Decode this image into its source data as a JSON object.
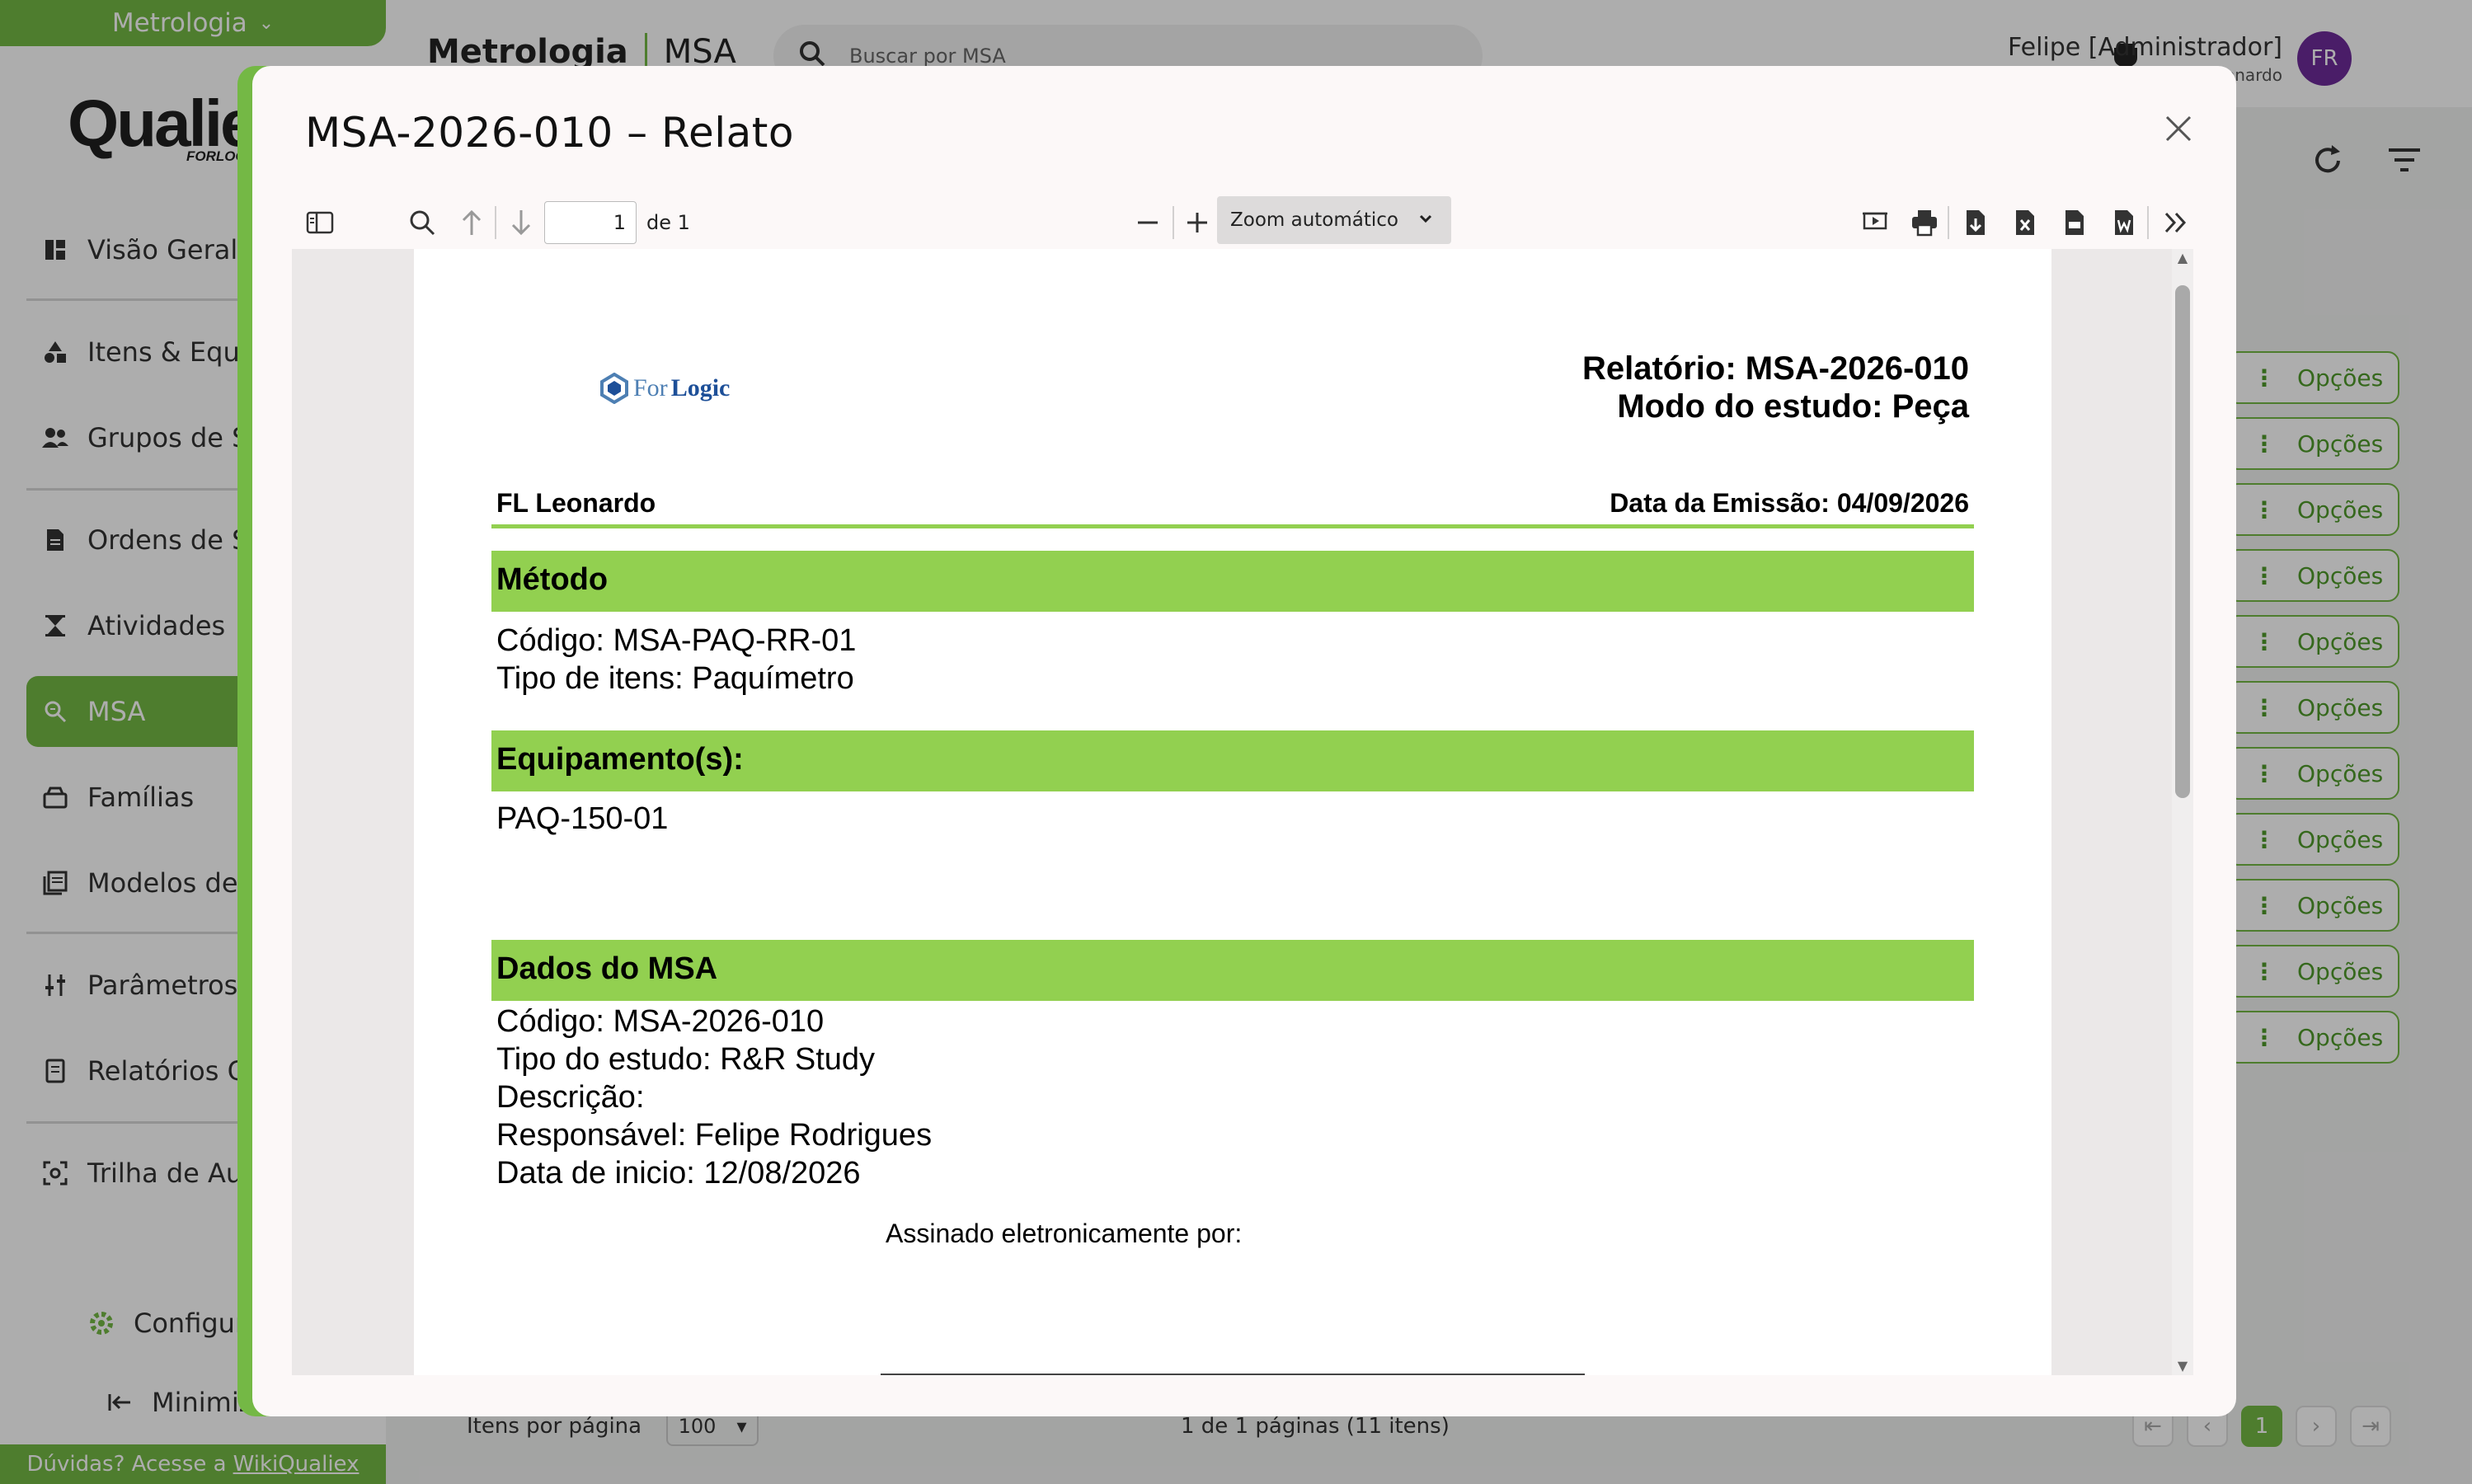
{
  "app": {
    "module": "Metrologia",
    "brand": "Qualiex",
    "brand_sub": "FORLOGIC"
  },
  "sidebar": {
    "items": [
      {
        "label": "Visão Geral",
        "icon": "dashboard-icon"
      },
      {
        "label": "Itens & Equipamentos",
        "icon": "shapes-icon"
      },
      {
        "label": "Grupos de Segurança",
        "icon": "users-icon"
      },
      {
        "label": "Ordens de Serviço",
        "icon": "document-icon"
      },
      {
        "label": "Atividades",
        "icon": "hourglass-icon"
      },
      {
        "label": "MSA",
        "icon": "search-icon"
      },
      {
        "label": "Famílias",
        "icon": "archive-icon"
      },
      {
        "label": "Modelos de Relatório",
        "icon": "list-icon"
      },
      {
        "label": "Parâmetros",
        "icon": "sliders-icon"
      },
      {
        "label": "Relatórios Gerenciais",
        "icon": "report-icon"
      },
      {
        "label": "Trilha de Auditoria",
        "icon": "audit-icon"
      }
    ],
    "config_label": "Configurações",
    "minimize_label": "Minimizar",
    "help_prefix": "Dúvidas? Acesse a",
    "help_link": "WikiQualiex"
  },
  "header": {
    "crumb_module": "Metrologia",
    "crumb_page": "MSA",
    "search_placeholder": "Buscar por MSA",
    "user_name": "Felipe [Administrador]",
    "user_org": "FL Leonardo",
    "avatar_initials": "FR"
  },
  "table": {
    "options_label": "Opções",
    "row_count": 11,
    "items_per_page_label": "Itens por página",
    "items_per_page": "100",
    "page_info": "1 de 1 páginas (11 itens)",
    "current_page": "1"
  },
  "modal": {
    "title": "MSA-2026-010 – Relato",
    "viewer": {
      "page_number": "1",
      "page_total": "de 1",
      "zoom": "Zoom automático"
    }
  },
  "report": {
    "title_line1": "Relatório: MSA-2026-010",
    "title_line2": "Modo do estudo: Peça",
    "org": "FL Leonardo",
    "emission": "Data da Emissão: 04/09/2026",
    "method_header": "Método",
    "method_code": "Código: MSA-PAQ-RR-01",
    "method_type": "Tipo de itens: Paquímetro",
    "equip_header": "Equipamento(s):",
    "equip_item": "PAQ-150-01",
    "data_header": "Dados do MSA",
    "data_code": "Código: MSA-2026-010",
    "data_type": "Tipo do estudo: R&R Study",
    "data_desc": "Descrição:",
    "data_resp": "Responsável: Felipe Rodrigues",
    "data_start": "Data de inicio: 12/08/2026",
    "signed": "Assinado eletronicamente por:"
  },
  "colors": {
    "accent": "#74b845",
    "report_band": "#92d050",
    "avatar": "#6d2b9a"
  }
}
